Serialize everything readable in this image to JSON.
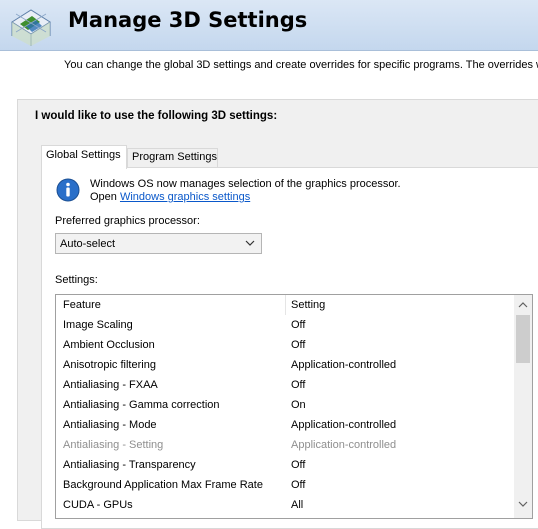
{
  "header": {
    "title": "Manage 3D Settings",
    "description": "You can change the global 3D settings and create overrides for specific programs. The overrides will"
  },
  "panel": {
    "heading": "I would like to use the following 3D settings:",
    "tabs": [
      {
        "label": "Global Settings",
        "selected": true
      },
      {
        "label": "Program Settings",
        "selected": false
      }
    ],
    "info": {
      "line1": "Windows OS now manages selection of the graphics processor.",
      "open_prefix": "Open ",
      "link": "Windows graphics settings"
    },
    "preferred_label": "Preferred graphics processor:",
    "preferred_value": "Auto-select",
    "settings_label": "Settings:",
    "table": {
      "columns": [
        "Feature",
        "Setting"
      ],
      "rows": [
        {
          "feature": "Image Scaling",
          "setting": "Off",
          "disabled": false
        },
        {
          "feature": "Ambient Occlusion",
          "setting": "Off",
          "disabled": false
        },
        {
          "feature": "Anisotropic filtering",
          "setting": "Application-controlled",
          "disabled": false
        },
        {
          "feature": "Antialiasing - FXAA",
          "setting": "Off",
          "disabled": false
        },
        {
          "feature": "Antialiasing - Gamma correction",
          "setting": "On",
          "disabled": false
        },
        {
          "feature": "Antialiasing - Mode",
          "setting": "Application-controlled",
          "disabled": false
        },
        {
          "feature": "Antialiasing - Setting",
          "setting": "Application-controlled",
          "disabled": true
        },
        {
          "feature": "Antialiasing - Transparency",
          "setting": "Off",
          "disabled": false
        },
        {
          "feature": "Background Application Max Frame Rate",
          "setting": "Off",
          "disabled": false
        },
        {
          "feature": "CUDA - GPUs",
          "setting": "All",
          "disabled": false
        }
      ]
    }
  },
  "colors": {
    "link": "#0a58ca",
    "header_bg": "#c4d7ee",
    "disabled_text": "#8f8f8f"
  },
  "icons": [
    "nvidia-3d-logo-icon",
    "info-icon",
    "chevron-down-icon",
    "scroll-up-arrow-icon",
    "scroll-down-arrow-icon"
  ]
}
